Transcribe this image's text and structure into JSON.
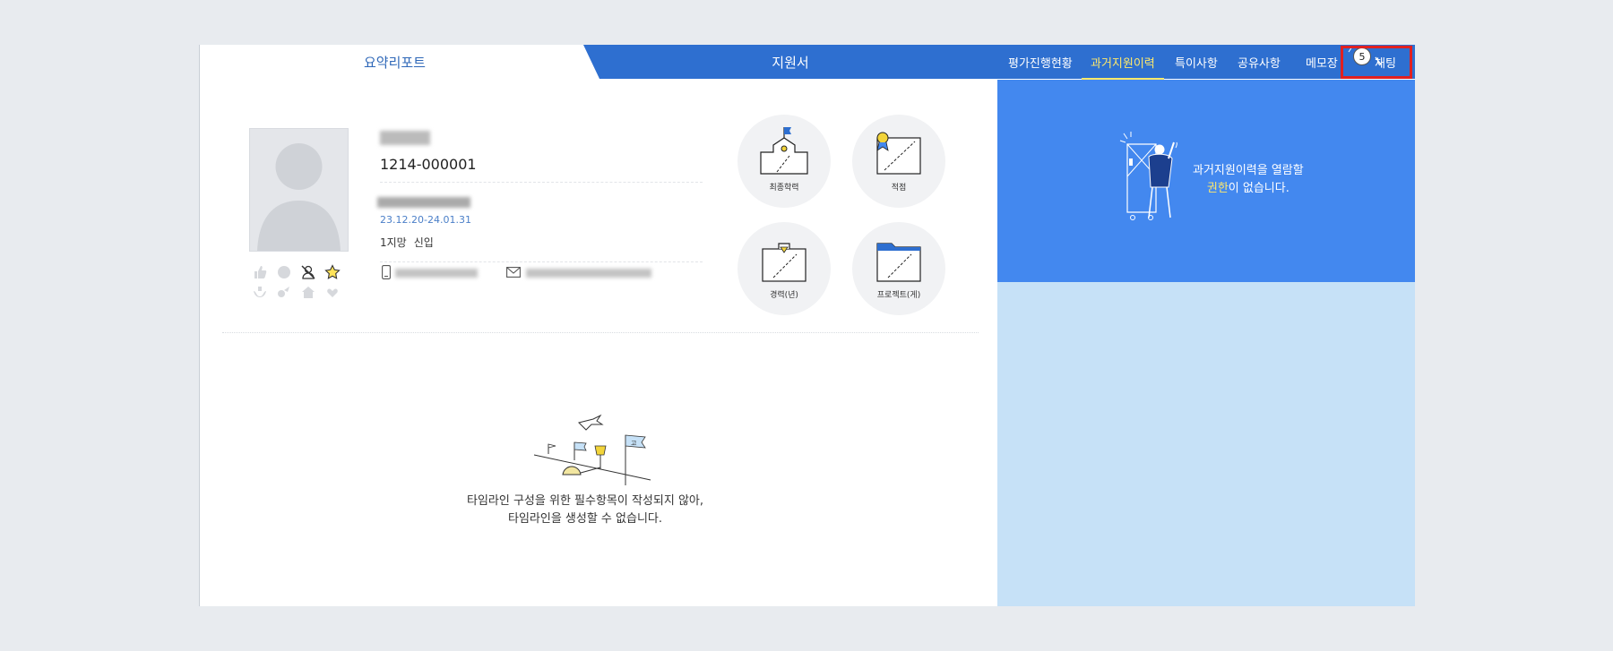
{
  "tabs": {
    "summary": "요약리포트",
    "application": "지원서"
  },
  "right_nav": {
    "items": [
      "평가진행현황",
      "과거지원이력",
      "특이사항",
      "공유사항",
      "메모장",
      "채팅"
    ],
    "active_index": 1,
    "chat_badge": "5"
  },
  "right_panel": {
    "line1": "과거지원이력을 열람할",
    "line2_highlight": "권한",
    "line2_rest": "이 없습니다."
  },
  "profile": {
    "application_id": "1214-000001",
    "period": "23.12.20-24.01.31",
    "choice": "1지망",
    "status": "신입"
  },
  "stats": {
    "education": "최종학력",
    "aptitude": "적점",
    "career": "경력(년)",
    "projects": "프로젝트(게)"
  },
  "timeline": {
    "line1": "타임라인 구성을 위한 필수항목이 작성되지 않아,",
    "line2": "타임라인을 생성할 수 없습니다."
  },
  "colors": {
    "primary": "#2e6fd0",
    "accent": "#ffe96b",
    "panel": "#4388ef",
    "panel_light": "#c6e1f7",
    "highlight_box": "#e02020"
  }
}
